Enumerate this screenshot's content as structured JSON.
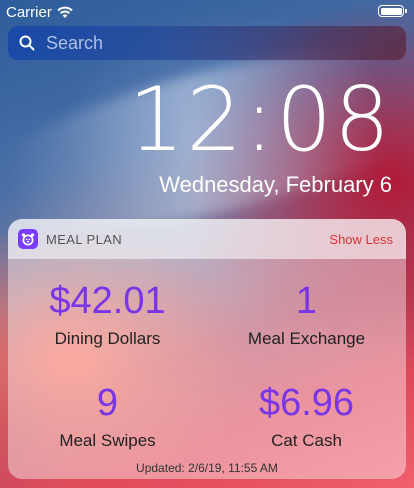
{
  "status_bar": {
    "carrier": "Carrier",
    "wifi_icon": "wifi-icon",
    "battery_icon": "battery-icon"
  },
  "search": {
    "placeholder": "Search",
    "icon": "search-icon"
  },
  "lock_screen": {
    "time": "12:08",
    "date": "Wednesday, February 6"
  },
  "widget": {
    "app_name": "MEAL PLAN",
    "app_icon": "meal-plan-app-icon",
    "toggle_label": "Show Less",
    "accent_color": "#7a35e6",
    "items": [
      {
        "value": "$42.01",
        "label": "Dining Dollars"
      },
      {
        "value": "1",
        "label": "Meal Exchange"
      },
      {
        "value": "9",
        "label": "Meal Swipes"
      },
      {
        "value": "$6.96",
        "label": "Cat Cash"
      }
    ],
    "updated": "Updated: 2/6/19, 11:55 AM"
  }
}
